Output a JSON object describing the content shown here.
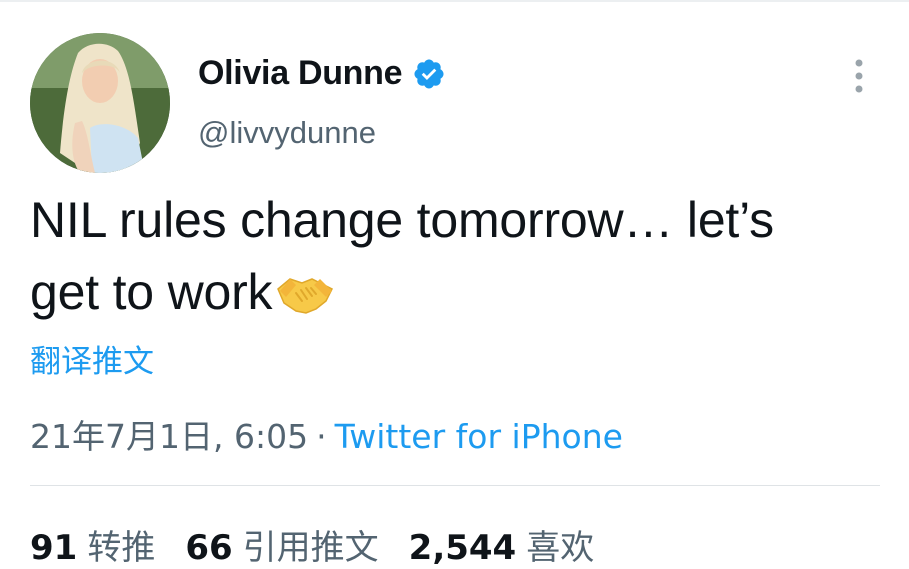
{
  "tweet": {
    "display_name": "Olivia Dunne",
    "handle": "@livvydunne",
    "text_line1": "NIL rules change tomorrow… let’s",
    "text_line2": "get to work",
    "translate_label": "翻译推文",
    "timestamp": "21年7月1日, 6:05",
    "separator": "·",
    "source": "Twitter for iPhone"
  },
  "stats": [
    {
      "count": "91",
      "label": "转推"
    },
    {
      "count": "66",
      "label": "引用推文"
    },
    {
      "count": "2,544",
      "label": "喜欢"
    }
  ],
  "icons": {
    "verified": "verified-badge-icon",
    "more": "more-vertical-icon",
    "emoji": "handshake-emoji"
  },
  "colors": {
    "accent": "#1d9bf0",
    "text": "#0f1419",
    "secondary": "#536471"
  }
}
